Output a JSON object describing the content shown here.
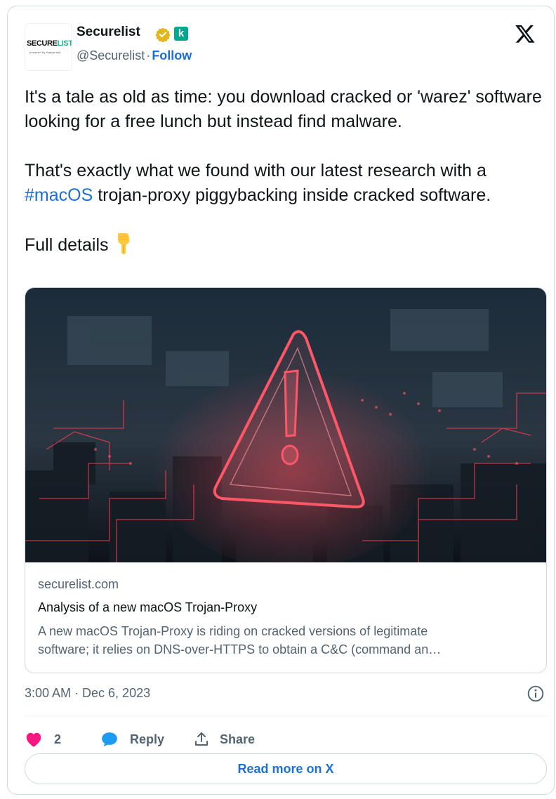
{
  "author": {
    "name": "Securelist",
    "handle": "@Securelist",
    "separator": "·",
    "follow_label": "Follow",
    "avatar_text_main": "SECURE",
    "avatar_text_accent": "LIST",
    "avatar_subtext": "powered by Kaspersky",
    "badge_letter": "k"
  },
  "tweet": {
    "para1": "It's a tale as old as time: you download cracked or 'warez' software looking for a free lunch but instead find malware.",
    "para2_prefix": "That's exactly what we found with our latest research with a ",
    "hashtag": "#macOS",
    "para2_suffix": " trojan-proxy piggybacking inside cracked software.",
    "para3": "Full details"
  },
  "link_card": {
    "domain": "securelist.com",
    "title": "Analysis of a new macOS Trojan-Proxy",
    "desc_line1": "A new macOS Trojan-Proxy is riding on cracked versions of legitimate",
    "desc_line2": "software; it relies on DNS-over-HTTPS to obtain a C&C (command an…"
  },
  "timestamp": "3:00 AM · Dec 6, 2023",
  "actions": {
    "like_count": "2",
    "reply_label": "Reply",
    "share_label": "Share"
  },
  "read_more_label": "Read more on X",
  "icons": {
    "verified": "verified-badge-icon",
    "x_logo": "x-logo-icon",
    "heart": "heart-icon",
    "reply": "reply-bubble-icon",
    "share": "share-upload-icon",
    "info": "info-icon",
    "pointing_down": "backhand-index-pointing-down-emoji"
  },
  "colors": {
    "link_blue": "#1d6fd1",
    "secondary_text": "#536471",
    "heart": "#f91880",
    "reply_blue": "#1d9bf0",
    "verified_gold": "#e2b719",
    "brand_green": "#00a88e",
    "border": "#cfd9de"
  }
}
